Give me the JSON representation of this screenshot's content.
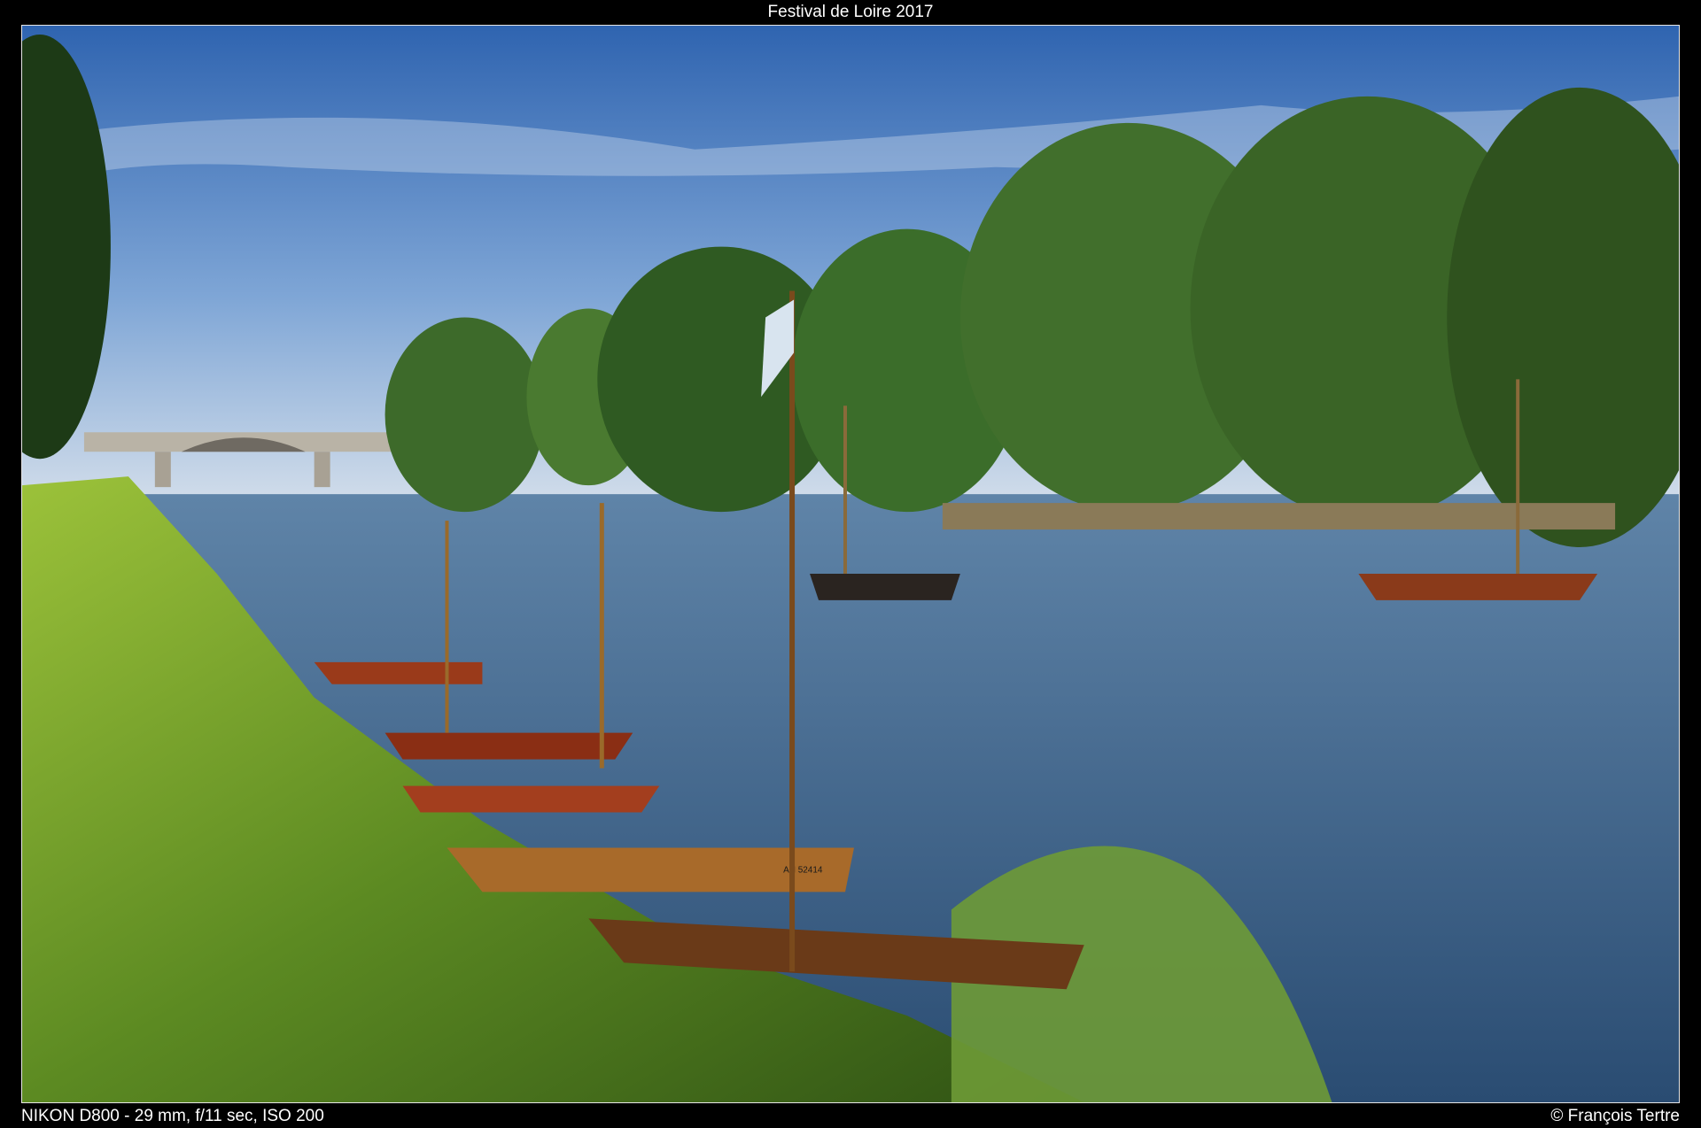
{
  "header": {
    "title": "Festival de Loire 2017"
  },
  "photo": {
    "subject": "wooden traditional sailing boats moored on a grassy river bank, with a stone bridge and tall trees under a blue sky",
    "boat_registration": "AN 52414"
  },
  "footer": {
    "exif": "NIKON D800 - 29 mm, f/11 sec, ISO 200",
    "credit": "© François Tertre"
  }
}
